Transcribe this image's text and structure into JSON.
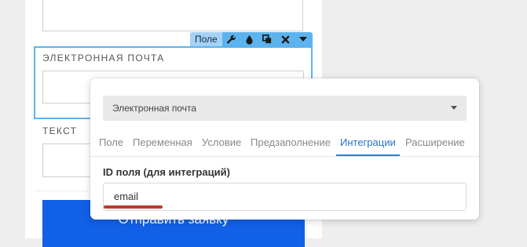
{
  "form": {
    "email_label": "ЭЛЕКТРОННАЯ ПОЧТА",
    "text_label": "ТЕКСТ",
    "submit_label": "Отправить заявку"
  },
  "toolbar": {
    "label": "Поле",
    "icons": [
      "wrench-icon",
      "drop-icon",
      "copy-icon",
      "close-icon",
      "chevron-down-icon"
    ]
  },
  "panel": {
    "select_value": "Электронная почта",
    "tabs": [
      "Поле",
      "Переменная",
      "Условие",
      "Предзаполнение",
      "Интеграции",
      "Расширение"
    ],
    "active_tab": "Интеграции",
    "field_id_label": "ID поля (для интеграций)",
    "field_id_value": "email"
  },
  "colors": {
    "toolbar_bg": "#5cb3ee",
    "submit_bg": "#1260e6",
    "active_tab": "#2373c4",
    "annotation_underline": "#c0392b"
  }
}
